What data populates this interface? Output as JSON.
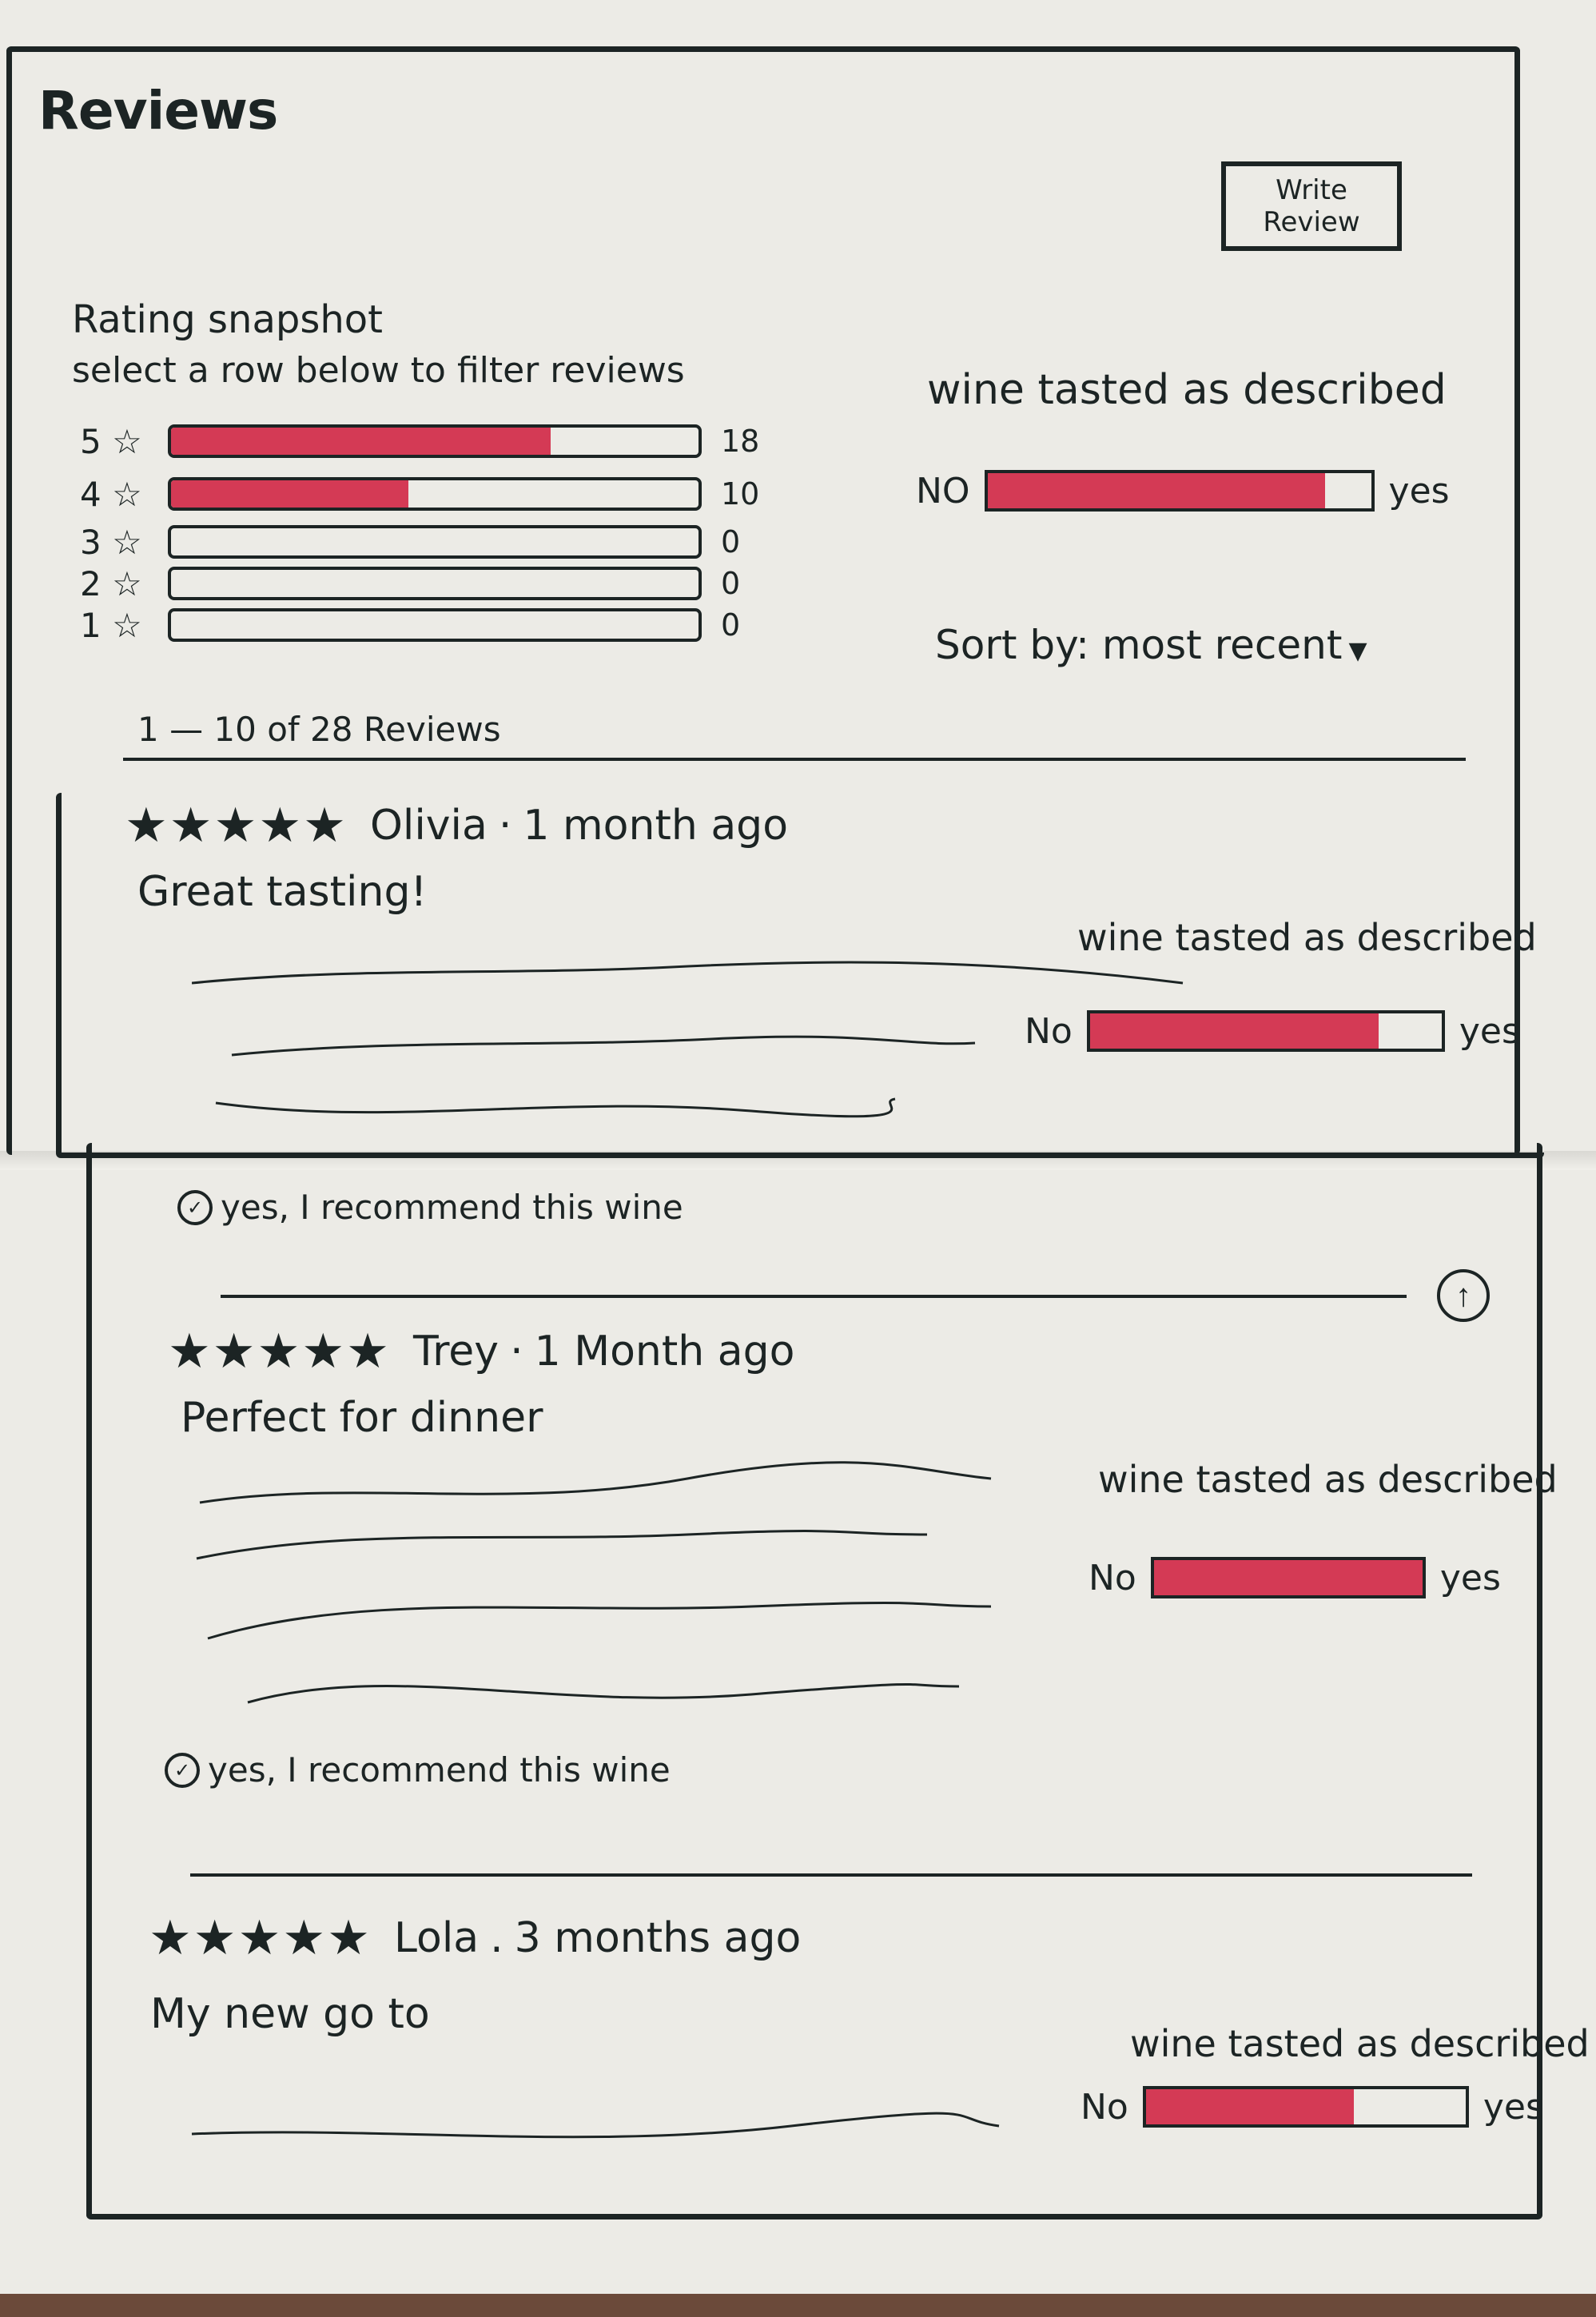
{
  "header": {
    "title": "Reviews",
    "write_review_label": "Write Review"
  },
  "snapshot": {
    "title": "Rating snapshot",
    "subtitle": "select a row below to filter reviews",
    "rows": [
      {
        "label": "5 ☆",
        "count": "18",
        "fill": 0.72
      },
      {
        "label": "4 ☆",
        "count": "10",
        "fill": 0.45
      },
      {
        "label": "3 ☆",
        "count": "0",
        "fill": 0
      },
      {
        "label": "2 ☆",
        "count": "0",
        "fill": 0
      },
      {
        "label": "1 ☆",
        "count": "0",
        "fill": 0
      }
    ]
  },
  "overall_wine_tasted": {
    "title": "wine tasted as described",
    "no_label": "NO",
    "yes_label": "yes",
    "fill": 0.88
  },
  "sort": {
    "label": "Sort by: most recent",
    "caret_icon": "triangle-down-icon"
  },
  "results_count": "1 — 10 of 28 Reviews",
  "reviews": [
    {
      "stars": "★★★★★",
      "author": "Olivia",
      "separator": "·",
      "when": "1 month ago",
      "headline": "Great tasting!",
      "wt_title": "wine tasted as described",
      "no_label": "No",
      "yes_label": "yes",
      "fill": 0.82,
      "recommend": "yes, I recommend this wine"
    },
    {
      "stars": "★★★★★",
      "author": "Trey",
      "separator": "·",
      "when": "1 Month ago",
      "headline": "Perfect for dinner",
      "wt_title": "wine tasted as described",
      "no_label": "No",
      "yes_label": "yes",
      "fill": 1.0,
      "recommend": "yes, I recommend this wine"
    },
    {
      "stars": "★★★★★",
      "author": "Lola",
      "separator": ".",
      "when": "3 months ago",
      "headline": "My new go to",
      "wt_title": "wine tasted as described",
      "no_label": "No",
      "yes_label": "yes",
      "fill": 0.65
    }
  ],
  "accent_color": "#d43a55",
  "ink_color": "#1c2424",
  "scroll_top_icon": "arrow-up-circle-icon"
}
